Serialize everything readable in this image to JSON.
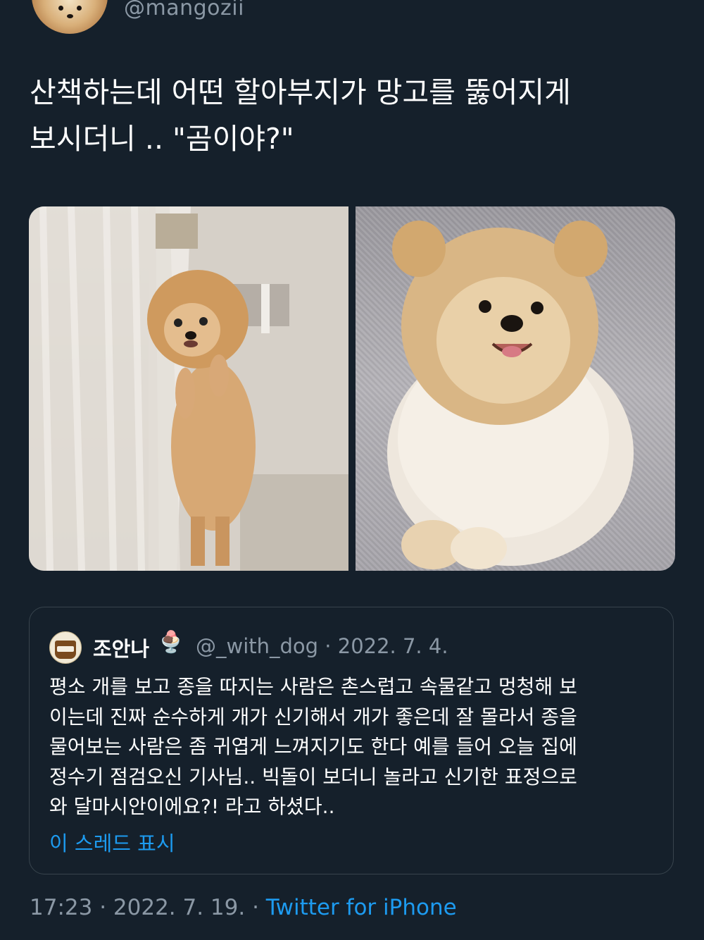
{
  "author": {
    "handle": "@mangozii"
  },
  "tweet": {
    "lines": [
      "산책하는데 어떤 할아부지가 망고를 뚫어지게",
      "보시더니 .. \"곰이야?\""
    ]
  },
  "media": {
    "photos": [
      {
        "description_icon": "dog-photo-standing"
      },
      {
        "description_icon": "dog-photo-lying"
      }
    ]
  },
  "quoted_tweet": {
    "display_name": "조안나",
    "emoji": "🍨",
    "handle_date": "@_with_dog · 2022. 7. 4.",
    "body_lines": [
      "평소 개를 보고 종을 따지는 사람은 촌스럽고 속물같고 멍청해 보",
      "이는데 진짜 순수하게 개가 신기해서 개가 좋은데 잘 몰라서 종을",
      "물어보는 사람은 좀 귀엽게 느껴지기도 한다 예를 들어 오늘 집에",
      "정수기 점검오신 기사님.. 빅돌이 보더니 놀라고 신기한 표정으로",
      "와 달마시안이에요?! 라고 하셨다.."
    ],
    "show_thread": "이 스레드 표시"
  },
  "meta": {
    "time_date": "17:23 · 2022. 7. 19. · ",
    "source": "Twitter for iPhone"
  },
  "colors": {
    "background": "#15202b",
    "secondary_text": "#8b98a5",
    "link": "#1d9bf0",
    "border": "#38444d"
  }
}
